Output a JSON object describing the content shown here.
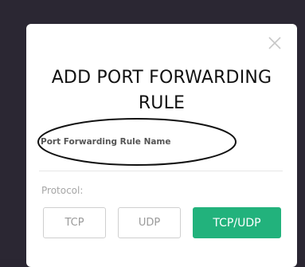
{
  "modal": {
    "title_line1": "ADD PORT FORWARDING",
    "title_line2": "RULE",
    "close_icon": "close-icon"
  },
  "form": {
    "rule_name_label": "Port Forwarding Rule Name",
    "protocol_label": "Protocol:",
    "protocol_options": [
      "TCP",
      "UDP",
      "TCP/UDP"
    ],
    "selected_protocol": "TCP/UDP"
  },
  "colors": {
    "accent": "#22b27c",
    "backdrop": "#2b2733"
  }
}
